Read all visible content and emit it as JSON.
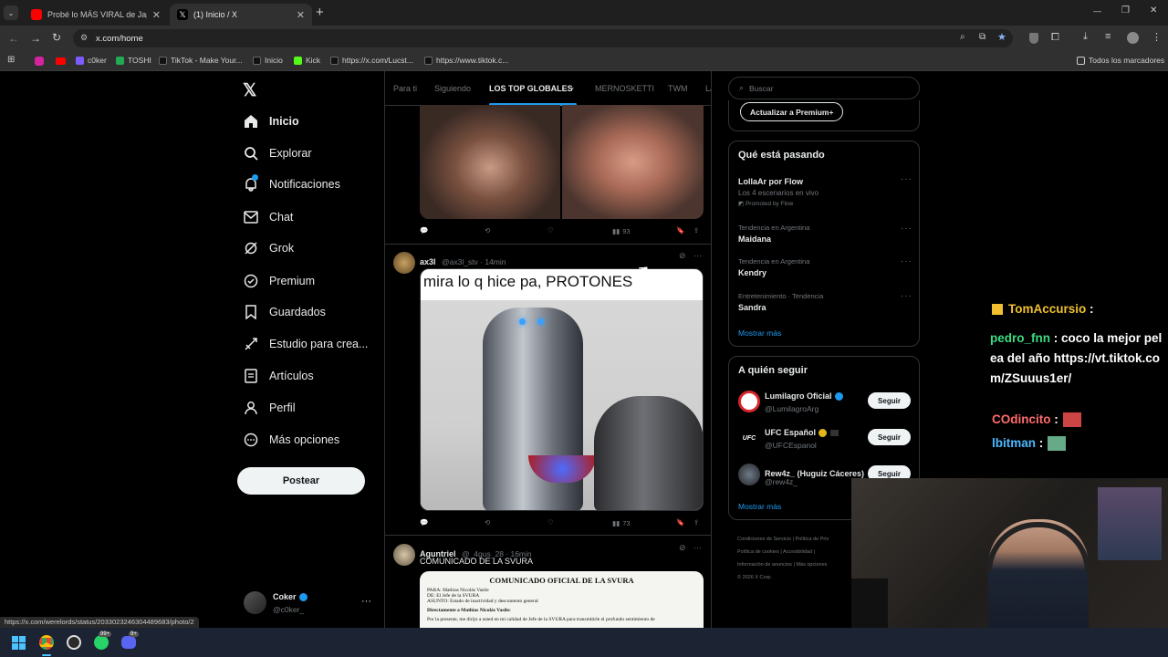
{
  "tabs": [
    {
      "title": "Probé lo MÁS VIRAL de Japón",
      "close": "✕"
    },
    {
      "title": "(1) Inicio / X",
      "close": "✕"
    }
  ],
  "new_tab": "+",
  "window_controls": {
    "minimize": "—",
    "restore": "❐",
    "close": "✕"
  },
  "address": "x.com/home",
  "bookmarks": [
    {
      "label": "c0ker",
      "color": "#7c5cff"
    },
    {
      "label": "TOSHI",
      "color": "#22aa55"
    },
    {
      "label": "TikTok - Make Your...",
      "color": "#111111"
    },
    {
      "label": "Inicio",
      "color": "#111111"
    },
    {
      "label": "Kick",
      "color": "#53fc18"
    },
    {
      "label": "https://x.com/Lucst...",
      "color": "#111111"
    },
    {
      "label": "https://www.tiktok.c...",
      "color": "#111111"
    }
  ],
  "all_bookmarks": "Todos los marcadores",
  "nav": {
    "items": [
      {
        "label": "Inicio",
        "icon": "home-icon"
      },
      {
        "label": "Explorar",
        "icon": "search-icon"
      },
      {
        "label": "Notificaciones",
        "icon": "bell-icon"
      },
      {
        "label": "Chat",
        "icon": "mail-icon"
      },
      {
        "label": "Grok",
        "icon": "grok-icon"
      },
      {
        "label": "Premium",
        "icon": "verified-icon"
      },
      {
        "label": "Guardados",
        "icon": "bookmark-icon"
      },
      {
        "label": "Estudio para crea...",
        "icon": "rocket-icon"
      },
      {
        "label": "Artículos",
        "icon": "article-icon"
      },
      {
        "label": "Perfil",
        "icon": "person-icon"
      },
      {
        "label": "Más opciones",
        "icon": "more-circle-icon"
      }
    ],
    "post_button": "Postear",
    "account": {
      "name": "Coker",
      "handle": "@c0ker_",
      "more": "···"
    }
  },
  "feed_tabs": [
    "Para ti",
    "Siguiendo",
    "LOS TOP GLOBALES",
    "MERNOSKETTI",
    "TWM",
    "LA"
  ],
  "posts": [
    {
      "views": "93"
    },
    {
      "name": "ax3l",
      "meta": "@ax3l_stv · 14min",
      "image_caption": "mira lo q hice pa, PROTONES",
      "views": "73"
    },
    {
      "name": "Aguntriel",
      "meta": "@_4gus_28 · 16min",
      "text": "COMUNICADO DE LA SVURA",
      "doc": {
        "title": "COMUNICADO OFICIAL DE LA SVURA",
        "lines": [
          "PARA: Mathias Nicolás Vasile",
          "DE: El Jefe de la SVURA",
          "ASUNTO: Estado de inactividad y descontento general",
          "Directamente a Mathias Nicolás Vasile:",
          "Por la presente, me dirijo a usted en mi calidad de Jefe de la SVURA para transmitirle el profundo sentimiento de"
        ]
      }
    }
  ],
  "right": {
    "search_placeholder": "Buscar",
    "premium_button": "Actualizar a Premium+",
    "trends_title": "Qué está pasando",
    "trends": [
      {
        "title": "LollaAr por Flow",
        "sub": "Los 4 escenarios en vivo",
        "promo": "Promoted by Flow"
      },
      {
        "context": "Tendencia en Argentina",
        "title": "Maidana"
      },
      {
        "context": "Tendencia en Argentina",
        "title": "Kendry"
      },
      {
        "context": "Entretenimiento · Tendencia",
        "title": "Sandra"
      }
    ],
    "show_more": "Mostrar más",
    "follow_title": "A quién seguir",
    "follow": [
      {
        "name": "Lumilagro Oficial",
        "handle": "@LumilagroArg",
        "button": "Seguir"
      },
      {
        "name": "UFC Español",
        "handle": "@UFCEspanol",
        "button": "Seguir"
      },
      {
        "name": "Rew4z_ (Huguiz Cáceres)",
        "handle": "@rew4z_",
        "button": "Seguir"
      }
    ],
    "footer": [
      "Condiciones de Servicio",
      "Política de Priv",
      "Política de cookies",
      "Accesibilidad",
      "Información de anuncios",
      "Más opciones",
      "© 2026 X Corp."
    ]
  },
  "chat": [
    {
      "user": "TomAccursio",
      "msg": " :",
      "color": "#f0c030"
    },
    {
      "user": "pedro_fnn",
      "msg": " : coco la mejor pelea del año https://vt.tiktok.com/ZSuuus1er/",
      "color": "#3ddc84"
    },
    {
      "user": "COdincito",
      "msg": " :",
      "color": "#ff6b6b"
    },
    {
      "user": "lbitman",
      "msg": " :",
      "color": "#4db8ff"
    }
  ],
  "status_url": "https://x.com/werelords/status/2033023246304489683/photo/2",
  "taskbar_badges": {
    "whatsapp": "99+",
    "discord": "9+"
  }
}
